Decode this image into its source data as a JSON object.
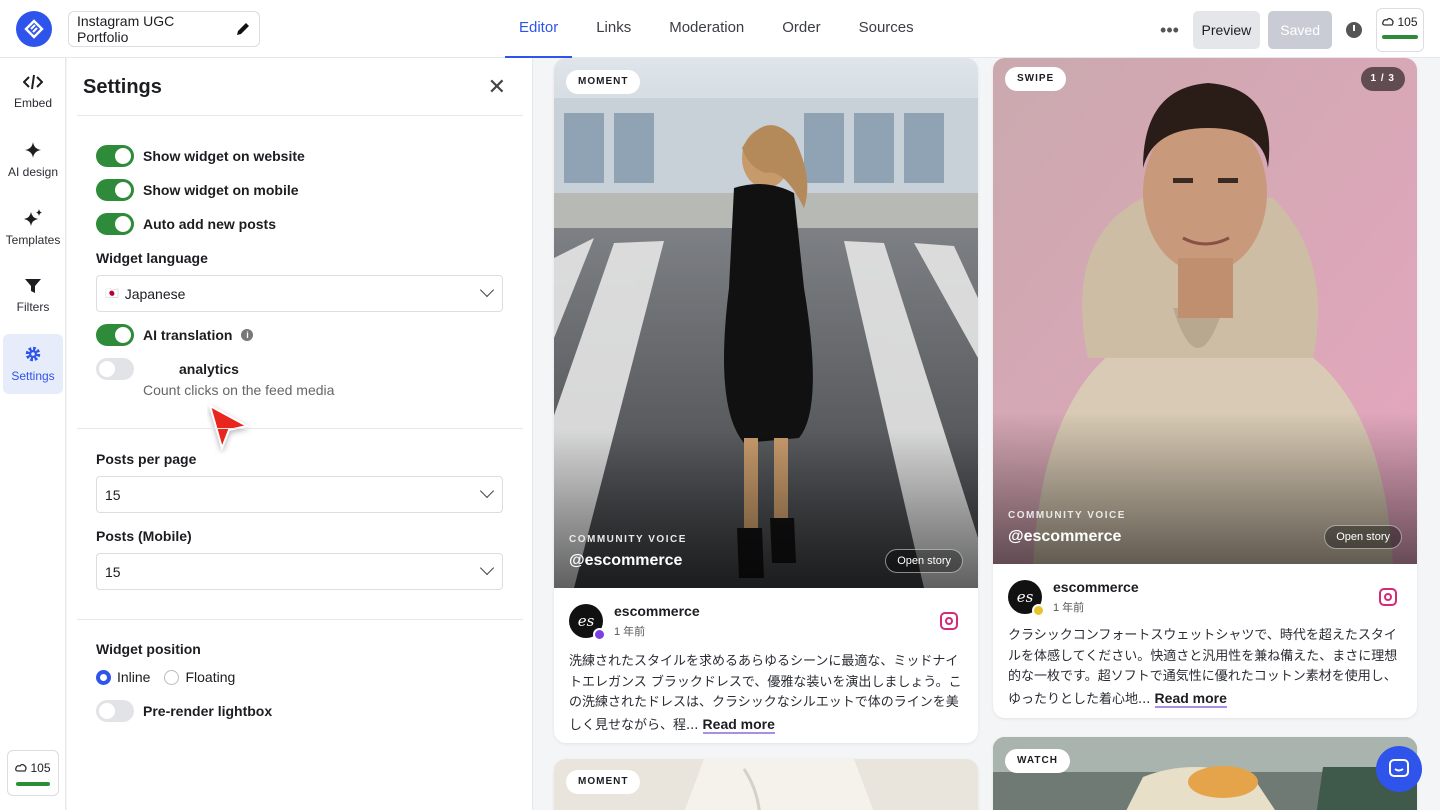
{
  "header": {
    "project_name": "Instagram UGC Portfolio",
    "tabs": [
      {
        "label": "Editor",
        "active": true
      },
      {
        "label": "Links",
        "active": false
      },
      {
        "label": "Moderation",
        "active": false
      },
      {
        "label": "Order",
        "active": false
      },
      {
        "label": "Sources",
        "active": false
      }
    ],
    "more_label": "•••",
    "preview_label": "Preview",
    "saved_label": "Saved",
    "credits": "105"
  },
  "rail": {
    "items": [
      {
        "label": "Embed",
        "icon": "code-icon"
      },
      {
        "label": "AI design",
        "icon": "sparkle-icon"
      },
      {
        "label": "Templates",
        "icon": "sparkles-icon"
      },
      {
        "label": "Filters",
        "icon": "funnel-icon"
      },
      {
        "label": "Settings",
        "icon": "gear-icon",
        "active": true
      }
    ],
    "credits": "105"
  },
  "settings": {
    "title": "Settings",
    "close": "✕",
    "show_website": "Show widget on website",
    "show_mobile": "Show widget on mobile",
    "auto_add": "Auto add new posts",
    "language_label": "Widget language",
    "language_flag": "🇯🇵",
    "language_value": "Japanese",
    "ai_translation": "AI translation",
    "info": "i",
    "analytics_label": "analytics",
    "analytics_sub": "Count clicks on the feed media",
    "posts_per_page_label": "Posts per page",
    "posts_per_page_value": "15",
    "posts_mobile_label": "Posts (Mobile)",
    "posts_mobile_value": "15",
    "position_label": "Widget position",
    "position_inline": "Inline",
    "position_floating": "Floating",
    "prerender": "Pre-render lightbox"
  },
  "feed": {
    "cards": [
      {
        "badge": "MOMENT",
        "community": "COMMUNITY VOICE",
        "handle": "@escommerce",
        "open": "Open story",
        "author": "escommerce",
        "time": "1 年前",
        "avatar_text": "es",
        "text": "洗練されたスタイルを求めるあらゆるシーンに最適な、ミッドナイトエレガンス ブラックドレスで、優雅な装いを演出しましょう。この洗練されたドレスは、クラシックなシルエットで体のラインを美しく見せながら、程...",
        "more": "Read more"
      },
      {
        "badge": "SWIPE",
        "counter": "1 / 3",
        "community": "COMMUNITY VOICE",
        "handle": "@escommerce",
        "open": "Open story",
        "author": "escommerce",
        "time": "1 年前",
        "avatar_text": "es",
        "text": "クラシックコンフォートスウェットシャツで、時代を超えたスタイルを体感してください。快適さと汎用性を兼ね備えた、まさに理想的な一枚です。超ソフトで通気性に優れたコットン素材を使用し、ゆったりとした着心地...",
        "more": "Read more"
      },
      {
        "badge": "MOMENT"
      },
      {
        "badge": "WATCH"
      }
    ]
  },
  "colors": {
    "accent": "#2f54eb",
    "toggle_on": "#2e8b3a",
    "read_more_underline": "#a98ee6"
  }
}
